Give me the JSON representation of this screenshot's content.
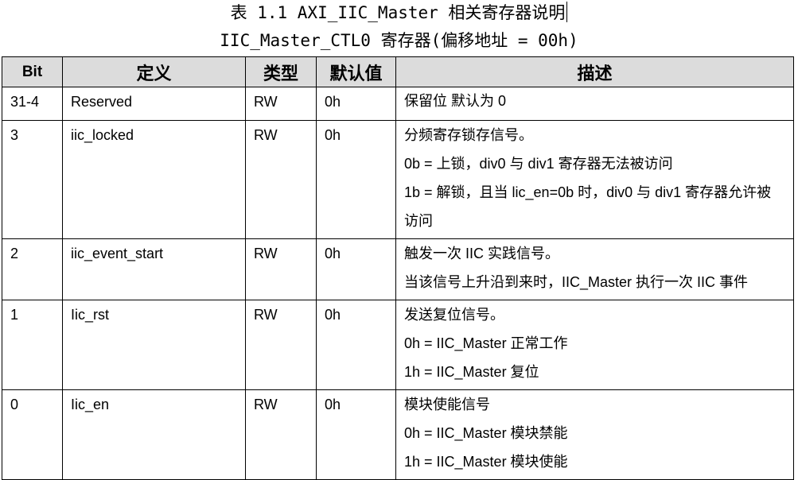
{
  "title_line1": "表 1.1 AXI_IIC_Master 相关寄存器说明",
  "title_line2": "IIC_Master_CTL0 寄存器(偏移地址 = 00h)",
  "headers": {
    "bit": "Bit",
    "def": "定义",
    "type": "类型",
    "default": "默认值",
    "desc": "描述"
  },
  "rows": [
    {
      "bit": "31-4",
      "def": "Reserved",
      "type": "RW",
      "default": "0h",
      "desc": [
        "保留位 默认为 0"
      ]
    },
    {
      "bit": "3",
      "def": "iic_locked",
      "type": "RW",
      "default": "0h",
      "desc": [
        "分频寄存锁存信号。",
        "0b = 上锁，div0 与 div1 寄存器无法被访问",
        "1b = 解锁，且当 lic_en=0b 时，div0 与 div1 寄存器允许被",
        "访问"
      ]
    },
    {
      "bit": "2",
      "def": "iic_event_start",
      "type": "RW",
      "default": "0h",
      "desc": [
        "触发一次 IIC 实践信号。",
        "当该信号上升沿到来时，IIC_Master 执行一次 IIC 事件"
      ]
    },
    {
      "bit": "1",
      "def": "Iic_rst",
      "type": "RW",
      "default": "0h",
      "desc": [
        "发送复位信号。",
        "0h = IIC_Master 正常工作",
        "1h = IIC_Master 复位"
      ]
    },
    {
      "bit": "0",
      "def": "Iic_en",
      "type": "RW",
      "default": "0h",
      "desc": [
        "模块使能信号",
        "0h = IIC_Master 模块禁能",
        "1h = IIC_Master 模块使能"
      ]
    }
  ]
}
